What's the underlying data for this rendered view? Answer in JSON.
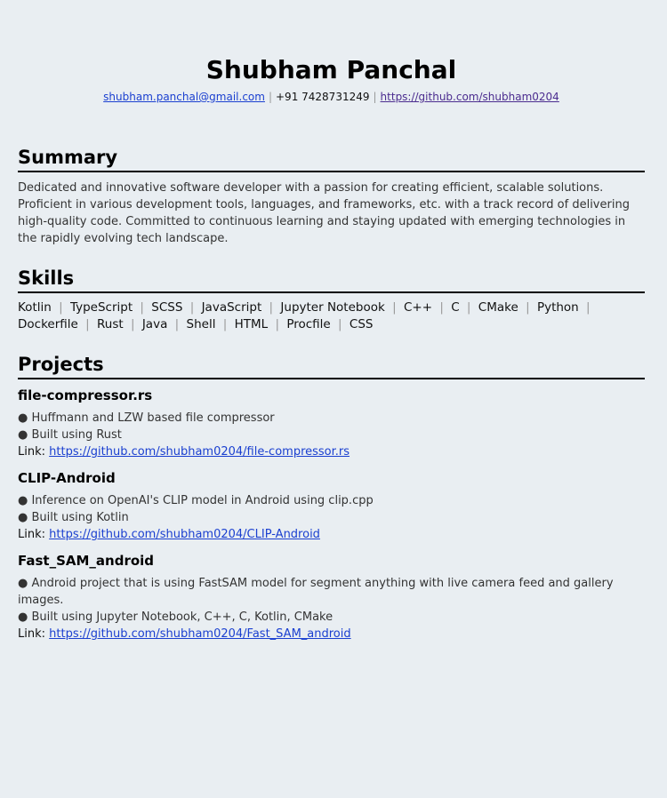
{
  "header": {
    "name": "Shubham Panchal",
    "email": "shubham.panchal@gmail.com",
    "phone": "+91 7428731249",
    "github": "https://github.com/shubham0204",
    "separator": "|"
  },
  "summary": {
    "title": "Summary",
    "text": "Dedicated and innovative software developer with a passion for creating efficient, scalable solutions. Proficient in various development tools, languages, and frameworks, etc. with a track record of delivering high-quality code. Committed to continuous learning and staying updated with emerging technologies in the rapidly evolving tech landscape."
  },
  "skills": {
    "title": "Skills",
    "items": [
      "Kotlin",
      "TypeScript",
      "SCSS",
      "JavaScript",
      "Jupyter Notebook",
      "C++",
      "C",
      "CMake",
      "Python",
      "Dockerfile",
      "Rust",
      "Java",
      "Shell",
      "HTML",
      "Procfile",
      "CSS"
    ]
  },
  "projects": {
    "title": "Projects",
    "link_label": "Link:",
    "items": [
      {
        "name": "file-compressor.rs",
        "bullets": [
          "● Huffmann and LZW based file compressor",
          "● Built using Rust"
        ],
        "url": "https://github.com/shubham0204/file-compressor.rs"
      },
      {
        "name": "CLIP-Android",
        "bullets": [
          "● Inference on OpenAI's CLIP model in Android using clip.cpp",
          "● Built using Kotlin"
        ],
        "url": "https://github.com/shubham0204/CLIP-Android"
      },
      {
        "name": "Fast_SAM_android",
        "bullets": [
          "● Android project that is using FastSAM model for segment anything with live camera feed and gallery images.",
          "● Built using Jupyter Notebook, C++, C, Kotlin, CMake"
        ],
        "url": "https://github.com/shubham0204/Fast_SAM_android"
      }
    ]
  }
}
